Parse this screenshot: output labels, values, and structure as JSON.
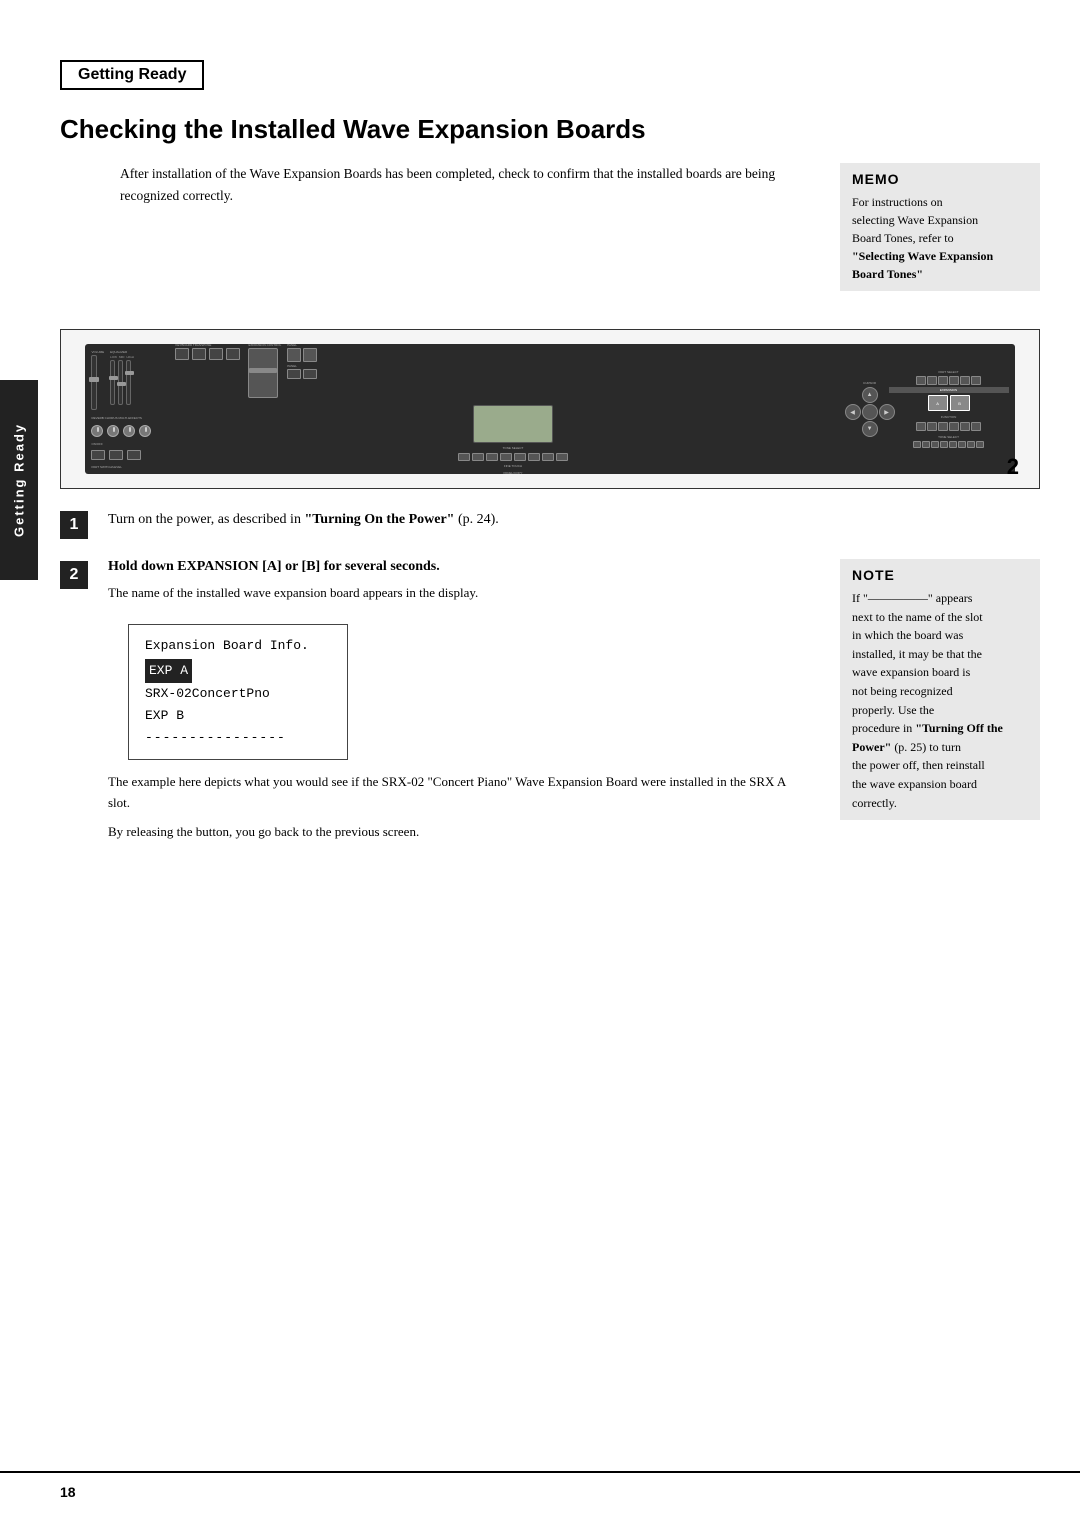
{
  "page": {
    "side_tab_label": "Getting Ready",
    "page_number": "18"
  },
  "header": {
    "section_label": "Getting Ready",
    "title": "Checking the Installed Wave Expansion Boards"
  },
  "intro": {
    "paragraph": "After installation of the Wave Expansion Boards has been completed, check to confirm that the installed boards are being recognized correctly."
  },
  "memo": {
    "title": "MEMO",
    "line1": "For instructions on",
    "line2": "selecting Wave Expansion",
    "line3": "Board Tones, refer to",
    "bold_text": "\"Selecting Wave Expansion Board Tones\""
  },
  "step1": {
    "number": "1",
    "text_before": "Turn on the power, as described in ",
    "bold_ref": "\"Turning On the Power\"",
    "text_after": " (p. 24)."
  },
  "step2": {
    "number": "2",
    "main_text": "Hold down EXPANSION [A] or [B] for several seconds.",
    "sub_text": "The name of the installed wave expansion board appears in the display.",
    "lcd": {
      "title": "Expansion Board Info.",
      "line1_highlight": "EXP A",
      "line2": "SRX-02ConcertPno",
      "line3": "EXP B",
      "line4": "----------------"
    },
    "desc1": "The example here depicts what you would see if the SRX-02 \"Concert Piano\" Wave Expansion Board were installed in the SRX A slot.",
    "desc2": "By releasing the button, you go back to the previous screen."
  },
  "note": {
    "title": "NOTE",
    "line1": "If \"",
    "dashes": "—————",
    "line1_end": "\" appears",
    "line2": "next to the name of the slot",
    "line3": "in which the board was",
    "line4": "installed, it may be that the",
    "line5": "wave expansion board is",
    "line6": "not being recognized",
    "line7": "properly. Use the",
    "line8_before": "procedure in ",
    "line8_bold": "\"Turning Off the Power\"",
    "line8_end": " (p. 25) to turn",
    "line9": "the power off, then reinstall",
    "line10": "the wave expansion board",
    "line11": "correctly."
  },
  "diagram_number": "2"
}
